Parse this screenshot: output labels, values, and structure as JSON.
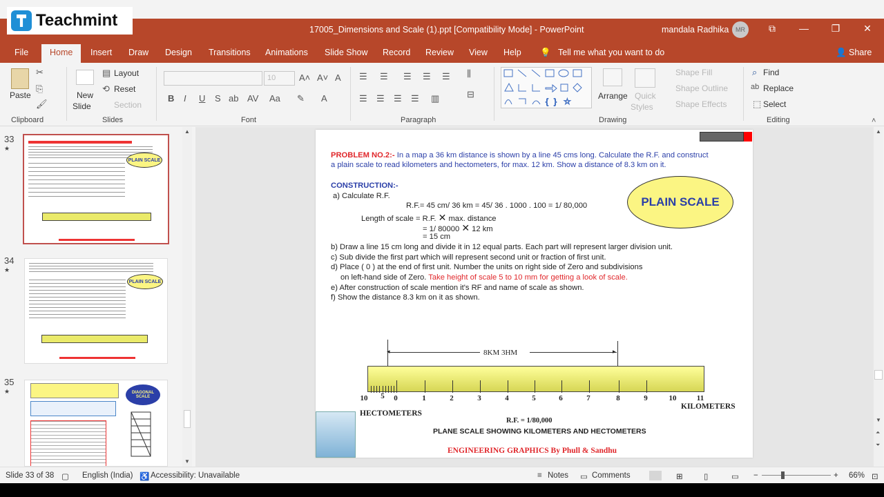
{
  "overlay": {
    "brand": "Teachmint"
  },
  "titlebar": {
    "document_title": "17005_Dimensions and Scale (1).ppt [Compatibility Mode]  -  PowerPoint",
    "user_name": "mandala Radhika",
    "avatar_initials": "MR",
    "accent_color": "#b7472a"
  },
  "menu": {
    "items": [
      "File",
      "Home",
      "Insert",
      "Draw",
      "Design",
      "Transitions",
      "Animations",
      "Slide Show",
      "Record",
      "Review",
      "View",
      "Help"
    ],
    "tell_me": "Tell me what you want to do",
    "share": "Share"
  },
  "ribbon": {
    "clipboard": {
      "paste": "Paste",
      "label": "Clipboard"
    },
    "slides": {
      "new_slide_1": "New",
      "new_slide_2": "Slide",
      "layout": "Layout",
      "reset": "Reset",
      "section": "Section",
      "label": "Slides"
    },
    "font": {
      "font_size": "10",
      "label": "Font"
    },
    "paragraph": {
      "label": "Paragraph"
    },
    "drawing": {
      "arrange": "Arrange",
      "quick_styles_1": "Quick",
      "quick_styles_2": "Styles",
      "shape_fill": "Shape Fill",
      "shape_outline": "Shape Outline",
      "shape_effects": "Shape Effects",
      "label": "Drawing"
    },
    "editing": {
      "find": "Find",
      "replace": "Replace",
      "select": "Select",
      "label": "Editing"
    }
  },
  "thumbnails": [
    {
      "number": "33",
      "badge": "PLAIN SCALE",
      "selected": true
    },
    {
      "number": "34",
      "badge": "PLAIN SCALE",
      "selected": false
    },
    {
      "number": "35",
      "badge": "DIAGONAL SCALE",
      "selected": false
    }
  ],
  "slide": {
    "problem_label": "PROBLEM NO.2:-",
    "problem_text_1": " In a map a 36 km distance is shown by a line 45 cms long. Calculate the R.F. and construct",
    "problem_text_2": "a plain scale to read kilometers and hectometers, for max. 12 km. Show a distance of 8.3 km on it.",
    "construction_label": "CONSTRUCTION:-",
    "step_a": "a) Calculate R.F.",
    "rf_calc": "R.F.= 45 cm/ 36 km = 45/ 36 . 1000 . 100 = 1/ 80,000",
    "length_1": "Length of scale = R.F.",
    "length_1b": "max. distance",
    "length_2": "= 1/ 80000",
    "length_2b": "12 km",
    "length_3": "= 15 cm",
    "step_b": "b) Draw a line 15 cm long and divide it in 12 equal parts. Each part will represent larger division unit.",
    "step_c": "c) Sub divide the first part which will represent second unit or fraction of first unit.",
    "step_d1": "d) Place ( 0 ) at the end of first unit. Number the units on right side of Zero and subdivisions",
    "step_d2": "on left-hand side of Zero.",
    "step_d2_red": " Take height of scale 5 to 10 mm for getting a look of scale.",
    "step_e": "e) After construction of scale mention it's RF and name of scale as shown.",
    "step_f": " f) Show the distance 8.3 km on it as shown.",
    "badge": "PLAIN SCALE",
    "dimension_label": "8KM  3HM",
    "tick_labels": [
      "10",
      "5",
      "0",
      "1",
      "2",
      "3",
      "4",
      "5",
      "6",
      "7",
      "8",
      "9",
      "10",
      "11"
    ],
    "hectometers": "HECTOMETERS",
    "kilometers": "KILOMETERS",
    "rf_caption": "R.F. = 1/80,000",
    "caption": "PLANE SCALE SHOWING KILOMETERS AND HECTOMETERS",
    "footer": "ENGINEERING GRAPHICS By Phull & Sandhu"
  },
  "status": {
    "slide_counter": "Slide 33 of 38",
    "language": "English (India)",
    "accessibility": "Accessibility: Unavailable",
    "notes": "Notes",
    "comments": "Comments",
    "zoom": "66%"
  }
}
